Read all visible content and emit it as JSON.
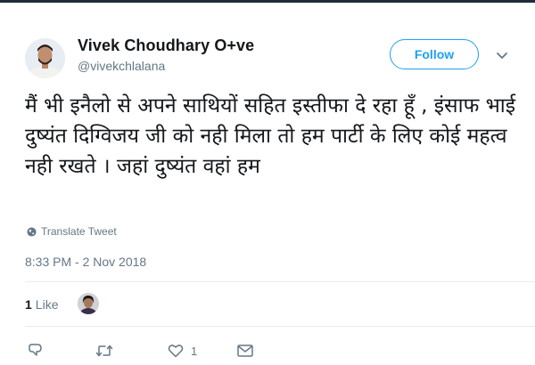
{
  "user": {
    "display_name": "Vivek Choudhary O+ve",
    "handle": "@vivekchlalana"
  },
  "follow_button": {
    "label": "Follow"
  },
  "tweet": {
    "text": "मैं भी इनैलो से अपने साथियों सहित इस्तीफा दे रहा हूँ , इंसाफ भाई दुष्यंत दिग्विजय जी को नही मिला तो हम पार्टी के लिए कोई महत्व नही रखते । जहां दुष्यंत वहां हम",
    "translate_label": "Translate Tweet",
    "timestamp": "8:33 PM - 2 Nov 2018"
  },
  "stats": {
    "likes_count": "1",
    "likes_label": "Like"
  },
  "actions": {
    "like_count": "1"
  },
  "icons": {
    "caret": "chevron-down-icon",
    "translate": "globe-icon",
    "reply": "reply-icon",
    "retweet": "retweet-icon",
    "like": "heart-icon",
    "dm": "envelope-icon"
  },
  "colors": {
    "accent": "#1da1f2",
    "text": "#14171a",
    "secondary": "#657786",
    "border": "#e6ecf0"
  }
}
